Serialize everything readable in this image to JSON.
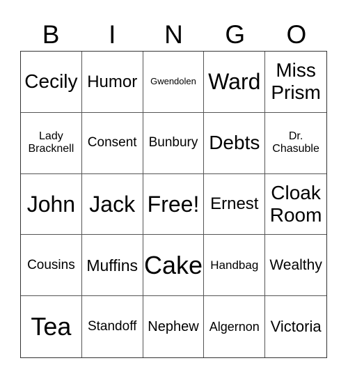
{
  "header": {
    "letters": [
      "B",
      "I",
      "N",
      "G",
      "O"
    ]
  },
  "card": {
    "rows": [
      [
        "Cecily",
        "Humor",
        "Gwendolen",
        "Ward",
        "Miss\nPrism"
      ],
      [
        "Lady\nBracknell",
        "Consent",
        "Bunbury",
        "Debts",
        "Dr.\nChasuble"
      ],
      [
        "John",
        "Jack",
        "Free!",
        "Ernest",
        "Cloak\nRoom"
      ],
      [
        "Cousins",
        "Muffins",
        "Cake",
        "Handbag",
        "Wealthy"
      ],
      [
        "Tea",
        "Standoff",
        "Nephew",
        "Algernon",
        "Victoria"
      ]
    ]
  }
}
